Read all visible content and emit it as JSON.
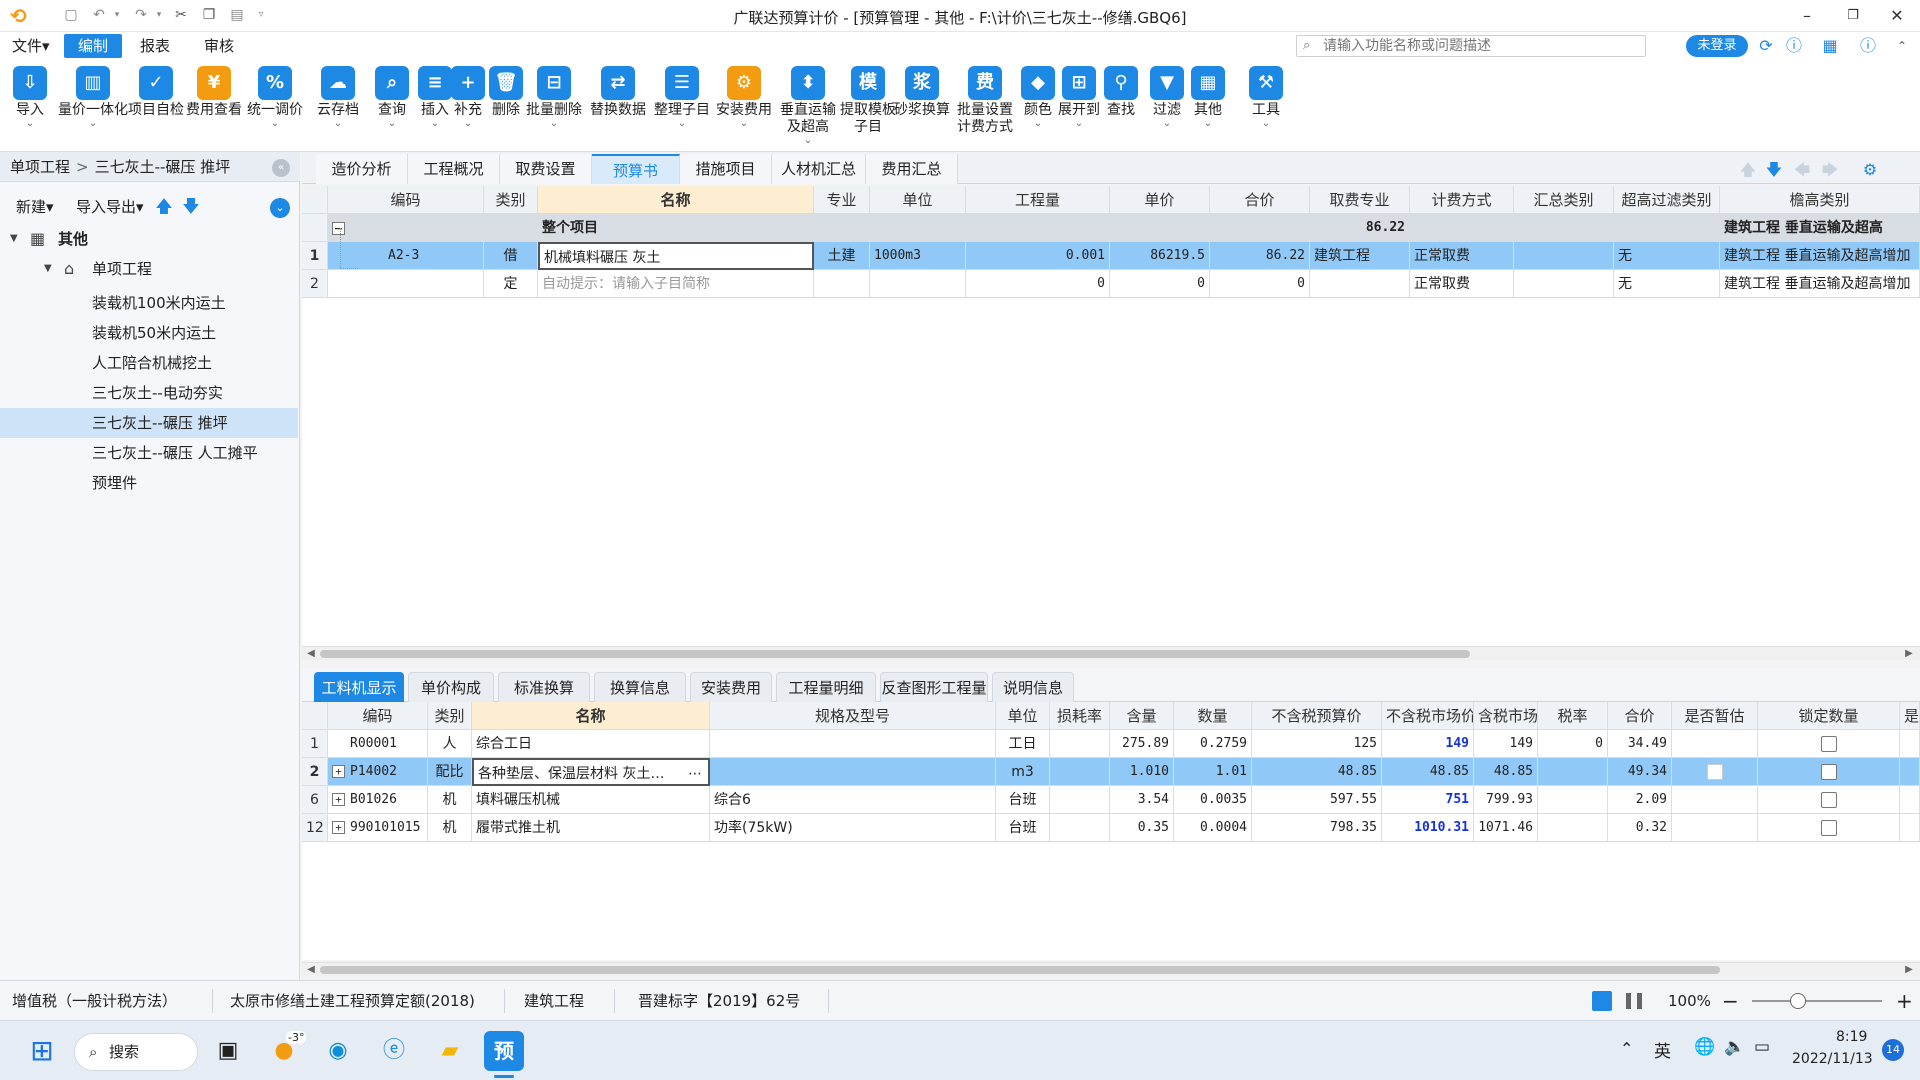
{
  "titlebar": {
    "title": "广联达预算计价 - [预算管理 - 其他 - F:\\计价\\三七灰土--修缮.GBQ6]",
    "minimize": "–",
    "restore": "❐",
    "close": "✕"
  },
  "menu": {
    "items": [
      "文件▾",
      "编制",
      "报表",
      "审核"
    ]
  },
  "search": {
    "placeholder": "请输入功能名称或问题描述"
  },
  "login_label": "未登录",
  "ribbon": {
    "buttons": [
      {
        "label": "导入",
        "icon": "import-icon",
        "glyph": "⇩",
        "dd": true
      },
      {
        "label": "量价一体化",
        "icon": "quantity-price-icon",
        "glyph": "▥",
        "dd": true
      },
      {
        "label": "项目自检",
        "icon": "self-check-icon",
        "glyph": "✓",
        "dd": false
      },
      {
        "label": "费用查看",
        "icon": "fee-view-icon",
        "glyph": "¥",
        "dd": false
      },
      {
        "label": "统一调价",
        "icon": "adjust-price-icon",
        "glyph": "%",
        "dd": true
      },
      {
        "label": "云存档",
        "icon": "cloud-save-icon",
        "glyph": "☁",
        "dd": true
      },
      {
        "label": "查询",
        "icon": "query-icon",
        "glyph": "⌕",
        "dd": true
      },
      {
        "label": "插入",
        "icon": "insert-icon",
        "glyph": "≡",
        "dd": true
      },
      {
        "label": "补充",
        "icon": "supplement-icon",
        "glyph": "+",
        "dd": true
      },
      {
        "label": "删除",
        "icon": "delete-icon",
        "glyph": "🗑",
        "dd": false
      },
      {
        "label": "批量删除",
        "icon": "batch-delete-icon",
        "glyph": "⊟",
        "dd": true
      },
      {
        "label": "替换数据",
        "icon": "replace-data-icon",
        "glyph": "⇄",
        "dd": false
      },
      {
        "label": "整理子目",
        "icon": "organize-items-icon",
        "glyph": "☰",
        "dd": true
      },
      {
        "label": "安装费用",
        "icon": "install-fee-icon",
        "glyph": "⚙",
        "dd": true
      },
      {
        "label": "垂直运输\n及超高",
        "icon": "vertical-transport-icon",
        "glyph": "⬍",
        "dd": true
      },
      {
        "label": "提取模板\n子目",
        "icon": "template-icon",
        "glyph": "模",
        "dd": false
      },
      {
        "label": "砂浆换算",
        "icon": "mortar-icon",
        "glyph": "浆",
        "dd": false
      },
      {
        "label": "批量设置\n计费方式",
        "icon": "batch-fee-icon",
        "glyph": "费",
        "dd": false
      },
      {
        "label": "颜色",
        "icon": "color-icon",
        "glyph": "◆",
        "dd": true
      },
      {
        "label": "展开到",
        "icon": "expand-icon",
        "glyph": "⊞",
        "dd": true
      },
      {
        "label": "查找",
        "icon": "find-icon",
        "glyph": "⚲",
        "dd": false
      },
      {
        "label": "过滤",
        "icon": "filter-icon",
        "glyph": "▼",
        "dd": true
      },
      {
        "label": "其他",
        "icon": "other-icon",
        "glyph": "▦",
        "dd": true
      },
      {
        "label": "工具",
        "icon": "tools-icon",
        "glyph": "⚒",
        "dd": true
      }
    ]
  },
  "left": {
    "crumb": [
      "单项工程",
      "三七灰土--碾压 推坪"
    ],
    "crumb_sep": ">",
    "tools": [
      "新建▾",
      "导入导出▾"
    ],
    "tree": [
      {
        "label": "其他",
        "level": 0,
        "icon": "building-icon",
        "expanded": true
      },
      {
        "label": "单项工程",
        "level": 1,
        "icon": "home-icon",
        "expanded": true
      },
      {
        "label": "装载机100米内运土",
        "level": 2
      },
      {
        "label": "装载机50米内运土",
        "level": 2
      },
      {
        "label": "人工陪合机械挖土",
        "level": 2
      },
      {
        "label": "三七灰土--电动夯实",
        "level": 2
      },
      {
        "label": "三七灰土--碾压 推坪",
        "level": 2,
        "selected": true
      },
      {
        "label": "三七灰土--碾压 人工摊平",
        "level": 2
      },
      {
        "label": "预埋件",
        "level": 2
      }
    ]
  },
  "top_tabs": [
    "造价分析",
    "工程概况",
    "取费设置",
    "预算书",
    "措施项目",
    "人材机汇总",
    "费用汇总"
  ],
  "top_active": 3,
  "upper": {
    "headers": [
      "编码",
      "类别",
      "名称",
      "专业",
      "单位",
      "工程量",
      "单价",
      "合价",
      "取费专业",
      "计费方式",
      "汇总类别",
      "超高过滤类别",
      "檐高类别"
    ],
    "group": {
      "name": "整个项目",
      "total": "86.22",
      "height_type": "建筑工程  垂直运输及超高"
    },
    "rows": [
      {
        "num": "1",
        "code": "A2-3",
        "type": "借",
        "name": "机械填料碾压 灰土",
        "major": "土建",
        "unit": "1000m3",
        "qty": "0.001",
        "price": "86219.5",
        "total": "86.22",
        "fee_major": "建筑工程",
        "method": "正常取费",
        "summary": "",
        "filter": "无",
        "height": "建筑工程  垂直运输及超高增加"
      },
      {
        "num": "2",
        "code": "",
        "type": "定",
        "name": "自动提示：请输入子目简称",
        "major": "",
        "unit": "",
        "qty": "0",
        "price": "0",
        "total": "0",
        "fee_major": "",
        "method": "正常取费",
        "summary": "",
        "filter": "无",
        "height": "建筑工程  垂直运输及超高增加"
      }
    ]
  },
  "bottom_tabs": [
    "工料机显示",
    "单价构成",
    "标准换算",
    "换算信息",
    "安装费用",
    "工程量明细",
    "反查图形工程量",
    "说明信息"
  ],
  "bottom_active": 0,
  "lower": {
    "headers": [
      "编码",
      "类别",
      "名称",
      "规格及型号",
      "单位",
      "损耗率",
      "含量",
      "数量",
      "不含税预算价",
      "不含税市场价",
      "含税市场价",
      "税率",
      "合价",
      "是否暂估",
      "锁定数量",
      "是否"
    ],
    "rows": [
      {
        "num": "1",
        "plus": false,
        "code": "R00001",
        "type": "人",
        "name": "综合工日",
        "spec": "",
        "unit": "工日",
        "loss": "",
        "content": "275.89",
        "qty": "0.2759",
        "budget": "125",
        "market": "149",
        "market_blue": true,
        "tax_market": "149",
        "rate": "0",
        "total": "34.49",
        "est": false,
        "lock": true
      },
      {
        "num": "2",
        "plus": true,
        "code": "P14002",
        "type": "配比",
        "name": "各种垫层、保温层材料 灰土…",
        "spec": "",
        "unit": "m3",
        "loss": "",
        "content": "1.010",
        "qty": "1.01",
        "budget": "48.85",
        "market": "48.85",
        "market_blue": false,
        "tax_market": "48.85",
        "rate": "",
        "total": "49.34",
        "est": true,
        "lock": true,
        "selected": true
      },
      {
        "num": "6",
        "plus": true,
        "code": "B01026",
        "type": "机",
        "name": "填料碾压机械",
        "spec": "综合6",
        "unit": "台班",
        "loss": "",
        "content": "3.54",
        "qty": "0.0035",
        "budget": "597.55",
        "market": "751",
        "market_blue": true,
        "tax_market": "799.93",
        "rate": "",
        "total": "2.09",
        "est": false,
        "lock": true
      },
      {
        "num": "12",
        "plus": true,
        "code": "990101015",
        "type": "机",
        "name": "履带式推土机",
        "spec": "功率(75kW)",
        "unit": "台班",
        "loss": "",
        "content": "0.35",
        "qty": "0.0004",
        "budget": "798.35",
        "market": "1010.31",
        "market_blue": true,
        "tax_market": "1071.46",
        "rate": "",
        "total": "0.32",
        "est": false,
        "lock": true
      }
    ]
  },
  "status": {
    "items": [
      "增值税（一般计税方法）",
      "太原市修缮土建工程预算定额(2018)",
      "建筑工程",
      "晋建标字【2019】62号"
    ],
    "zoom": "100%"
  },
  "taskbar": {
    "search_label": "搜索",
    "weather": "-3°",
    "app_label": "预",
    "ime": "英",
    "time": "8:19",
    "date": "2022/11/13",
    "notif": "14"
  },
  "colors": {
    "accent": "#1e88e5",
    "selected_row": "#90c8f7",
    "market_blue": "#1432d6"
  }
}
